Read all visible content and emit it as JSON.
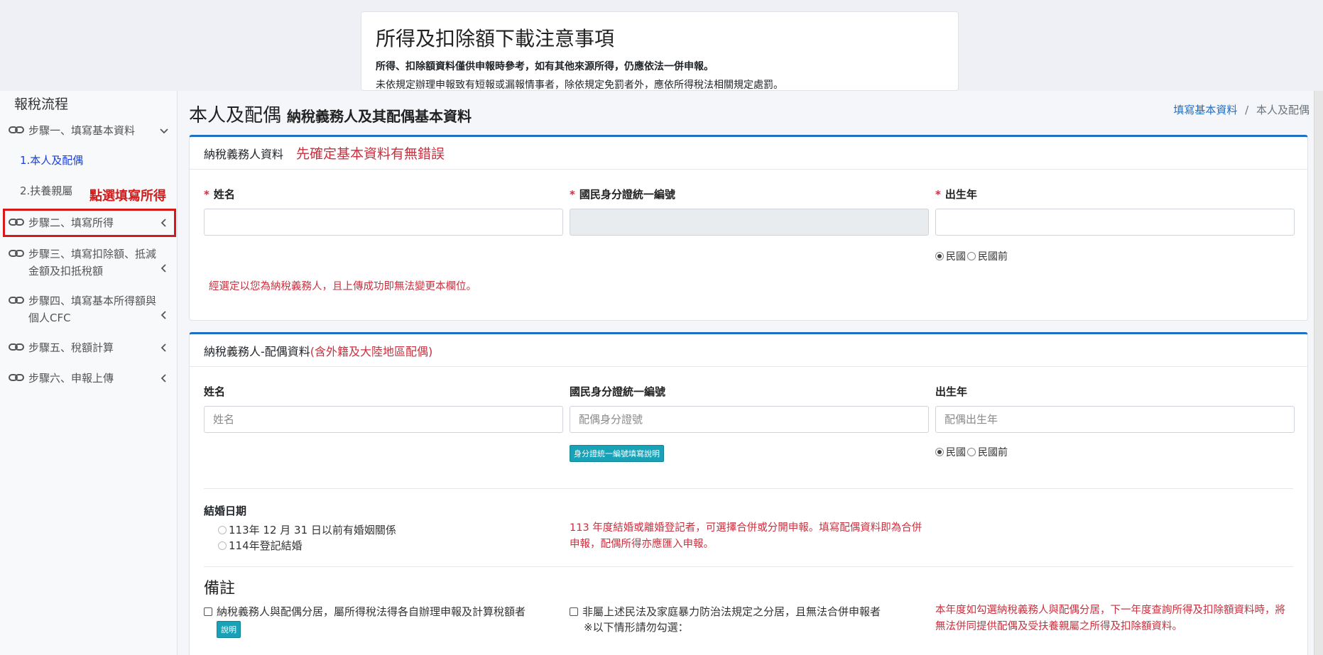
{
  "notice": {
    "title": "所得及扣除額下載注意事項",
    "line1": "所得、扣除額資料僅供申報時參考，如有其他來源所得，仍應依法一併申報。",
    "line2": "未依規定辦理申報致有短報或漏報情事者，除依規定免罰者外，應依所得稅法相關規定處罰。"
  },
  "sidebar": {
    "title": "報稅流程",
    "steps": [
      {
        "label": "步驟一、填寫基本資料"
      },
      {
        "label": "步驟二、填寫所得"
      },
      {
        "label": "步驟三、填寫扣除額、抵減金額及扣抵稅額"
      },
      {
        "label": "步驟四、填寫基本所得額與個人CFC"
      },
      {
        "label": "步驟五、稅額計算"
      },
      {
        "label": "步驟六、申報上傳"
      }
    ],
    "sub_items": [
      "1.本人及配偶",
      "2.扶養親屬"
    ],
    "annotation": "點選填寫所得"
  },
  "header": {
    "title": "本人及配偶",
    "subtitle": "納稅義務人及其配偶基本資料",
    "breadcrumb_link": "填寫基本資料",
    "breadcrumb_sep": "/",
    "breadcrumb_current": "本人及配偶"
  },
  "taxpayer": {
    "header": "納稅義務人資料",
    "warning": "先確定基本資料有無錯誤",
    "req_mark": "*",
    "name_label": "姓名",
    "id_label": "國民身分證統一編號",
    "birth_label": "出生年",
    "roc": "民國",
    "pre_roc": "民國前",
    "note": "經選定以您為納稅義務人，且上傳成功即無法變更本欄位。"
  },
  "spouse": {
    "header": "納稅義務人-配偶資料",
    "header_paren": "(含外籍及大陸地區配偶)",
    "name_label": "姓名",
    "name_placeholder": "姓名",
    "id_label": "國民身分證統一編號",
    "id_placeholder": "配偶身分證號",
    "id_help_button": "身分證統一編號填寫說明",
    "birth_label": "出生年",
    "birth_placeholder": "配偶出生年",
    "roc": "民國",
    "pre_roc": "民國前",
    "marriage_label": "結婚日期",
    "marriage_opt1": "113年 12 月 31 日以前有婚姻關係",
    "marriage_opt2": "114年登記結婚",
    "marriage_note": "113 年度結婚或離婚登記者，可選擇合併或分開申報。填寫配偶資料即為合併申報，配偶所得亦應匯入申報。",
    "remarks_title": "備註",
    "remark1": "納稅義務人與配偶分居，屬所得稅法得各自辦理申報及計算稅額者",
    "remark1_button": "說明",
    "remark2": "非屬上述民法及家庭暴力防治法規定之分居，且無法合併申報者",
    "remark2_sub": "※以下情形請勿勾選：",
    "remark_note": "本年度如勾選納稅義務人與配偶分居，下一年度查詢所得及扣除額資料時，將無法併同提供配偶及受扶養親屬之所得及扣除額資料。"
  }
}
